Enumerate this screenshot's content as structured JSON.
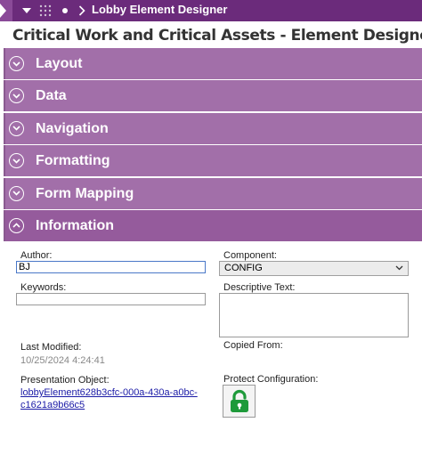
{
  "topbar": {
    "title": "Lobby Element Designer",
    "icons": [
      "caret-down-icon",
      "grid-icon",
      "dot-icon",
      "chevron-right-icon"
    ]
  },
  "page": {
    "title": "Critical Work and Critical Assets - Element Designer"
  },
  "accordion": {
    "sections": [
      {
        "label": "Layout",
        "expanded": false
      },
      {
        "label": "Data",
        "expanded": false
      },
      {
        "label": "Navigation",
        "expanded": false
      },
      {
        "label": "Formatting",
        "expanded": false
      },
      {
        "label": "Form Mapping",
        "expanded": false
      },
      {
        "label": "Information",
        "expanded": true
      }
    ]
  },
  "information": {
    "author_label": "Author:",
    "author_value": "BJ",
    "component_label": "Component:",
    "component_value": "CONFIG",
    "keywords_label": "Keywords:",
    "keywords_value": "",
    "descriptive_text_label": "Descriptive Text:",
    "descriptive_text_value": "",
    "last_modified_label": "Last Modified:",
    "last_modified_value": "10/25/2024 4:24:41",
    "copied_from_label": "Copied From:",
    "presentation_object_label": "Presentation Object:",
    "presentation_object_value": "lobbyElement628b3cfc-000a-430a-a0bc-c1621a9b66c5",
    "protect_configuration_label": "Protect Configuration:",
    "protect_state": "unlocked"
  },
  "colors": {
    "topbar": "#6b2b7b",
    "accordion": "#a26fa9",
    "lock_green": "#1e9a3a",
    "link": "#1a1aa6"
  }
}
